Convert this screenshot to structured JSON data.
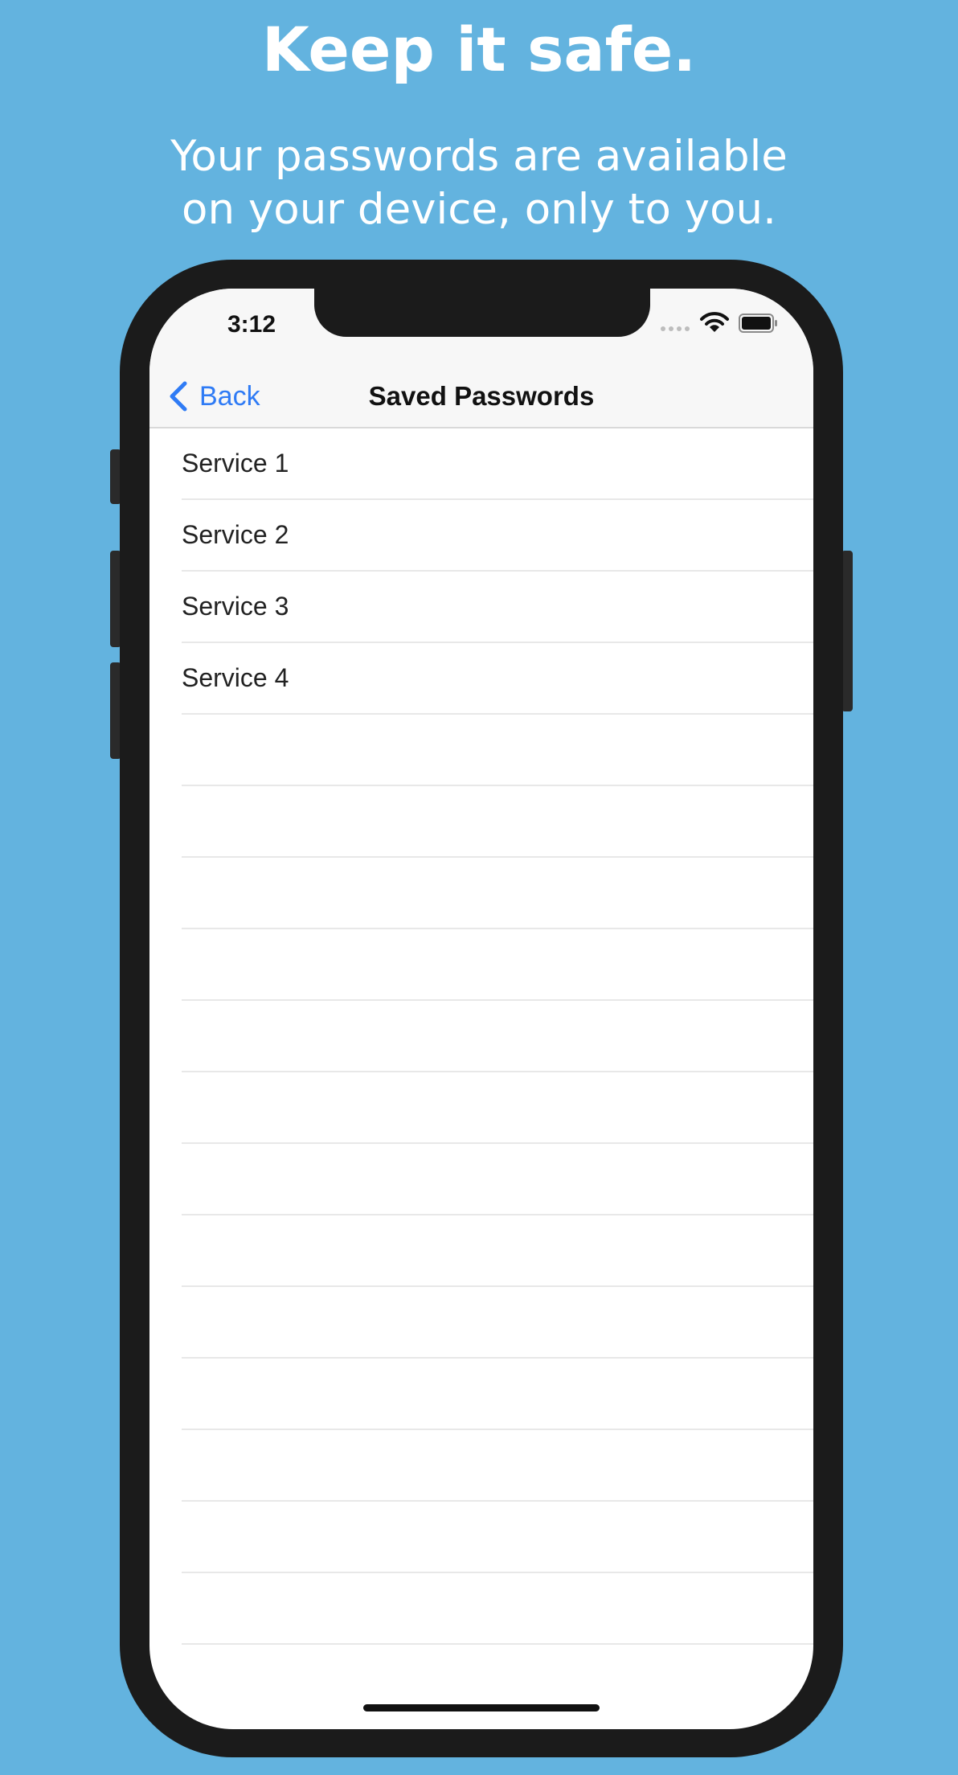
{
  "promo": {
    "headline": "Keep it safe.",
    "subline_1": "Your passwords are available",
    "subline_2": "on your device, only to you."
  },
  "status_bar": {
    "time": "3:12",
    "icons": [
      "cellular-signal-icon",
      "wifi-icon",
      "battery-icon"
    ]
  },
  "nav_bar": {
    "back_label": "Back",
    "title": "Saved Passwords"
  },
  "list": {
    "items": [
      "Service 1",
      "Service 2",
      "Service 3",
      "Service 4",
      "",
      "",
      "",
      "",
      "",
      "",
      "",
      "",
      "",
      "",
      "",
      "",
      ""
    ]
  },
  "colors": {
    "background": "#63b3df",
    "accent": "#2f7bf5",
    "device_frame": "#1b1b1b"
  }
}
